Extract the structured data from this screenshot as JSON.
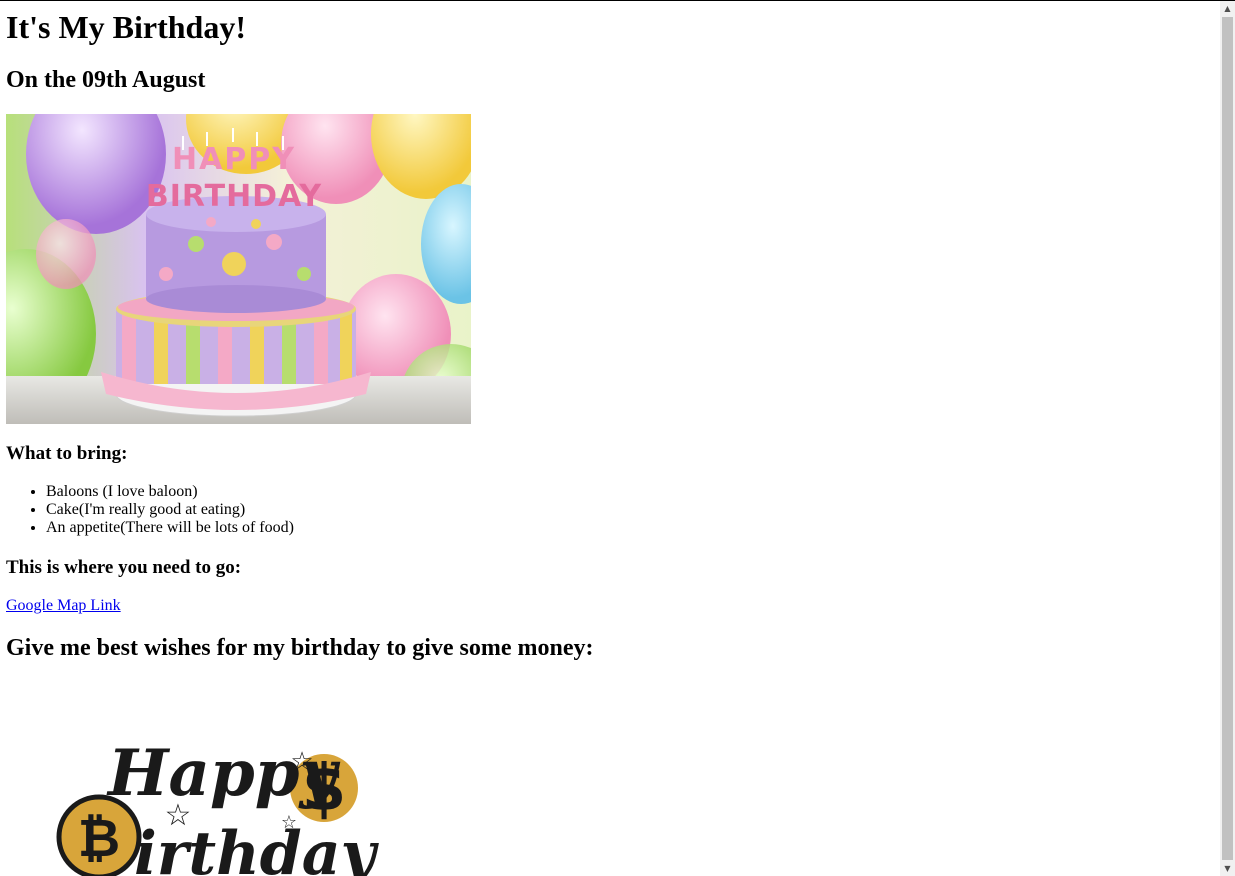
{
  "page": {
    "title": "It's My Birthday!",
    "date": "On the 09th August"
  },
  "bring": {
    "heading": "What to bring:",
    "items": [
      "Baloons (I love baloon)",
      "Cake(I'm really good at eating)",
      "An appetite(There will be lots of food)"
    ]
  },
  "location": {
    "heading": "This is where you need to go:",
    "link_label": "Google Map Link"
  },
  "wishes": {
    "heading": "Give me best wishes for my birthday to give some money:"
  },
  "images": {
    "cake_letters": "HAPPY BIRTHDAY",
    "topper_line1": "Happy",
    "topper_line2": "irthday"
  },
  "colors": {
    "link": "#0000ee"
  }
}
